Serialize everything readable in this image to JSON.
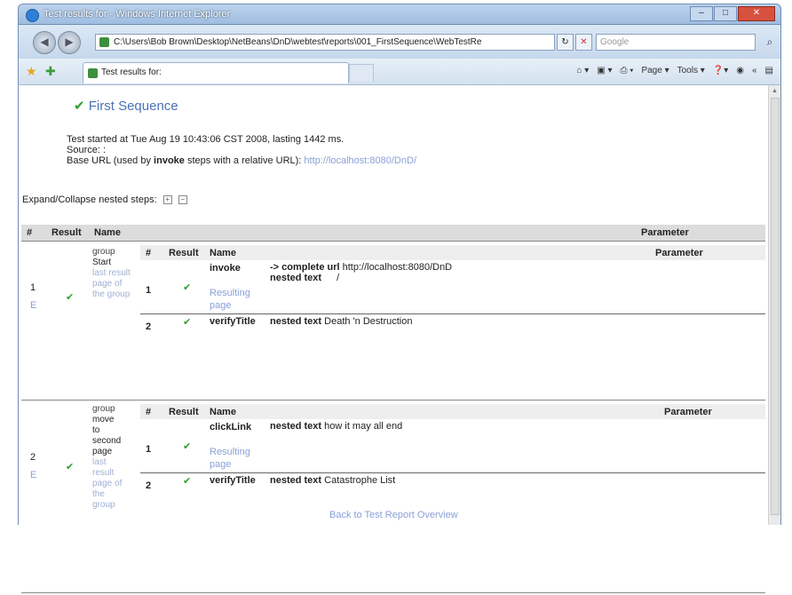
{
  "window": {
    "title": "Test results for - Windows Internet Explorer",
    "min": "–",
    "max": "□",
    "close": "✕"
  },
  "browser": {
    "back": "◀",
    "forward": "▶",
    "address": "C:\\Users\\Bob Brown\\Desktop\\NetBeans\\DnD\\webtest\\reports\\001_FirstSequence\\WebTestRe",
    "refresh_icon": "↻",
    "stop_icon": "✕",
    "search_placeholder": "Google",
    "search_icon": "⌕",
    "tab_title": "Test results for:",
    "commands": [
      "⌂ ▾",
      "▣ ▾",
      "⎙ ▾",
      "Page ▾",
      "Tools ▾",
      "❓▾",
      "◉",
      "«",
      "▤"
    ]
  },
  "report": {
    "heading": "First Sequence",
    "started": "Test started at Tue Aug 19 10:43:06 CST 2008, lasting 1442 ms.",
    "source": "Source: :",
    "base_url_prefix": "Base URL (used by",
    "base_url_keyword": "invoke",
    "base_url_suffix": "steps with a relative URL):",
    "base_url": "http://localhost:8080/DnD/",
    "expand_label": "Expand/Collapse nested steps:",
    "expand_plus": "+",
    "expand_minus": "−",
    "columns": {
      "num": "#",
      "result": "Result",
      "name": "Name",
      "parameter": "Parameter"
    },
    "groups": [
      {
        "num": "1",
        "collapse": "E",
        "type": "group",
        "name": "Start",
        "last_result": "last result page of the group",
        "steps": [
          {
            "num": "1",
            "name": "invoke",
            "resulting": "Resulting page",
            "p1_label": "-> complete url",
            "p1_value": "http://localhost:8080/DnD",
            "p2_label": "nested text",
            "p2_value": "/"
          },
          {
            "num": "2",
            "name": "verifyTitle",
            "p1_label": "nested text",
            "p1_value": "Death 'n Destruction"
          }
        ]
      },
      {
        "num": "2",
        "collapse": "E",
        "type": "group",
        "name": "move to second page",
        "last_result": "last result page of the group",
        "steps": [
          {
            "num": "1",
            "name": "clickLink",
            "resulting": "Resulting page",
            "p1_label": "nested text",
            "p1_value": "how it may all end"
          },
          {
            "num": "2",
            "name": "verifyTitle",
            "p1_label": "nested text",
            "p1_value": "Catastrophe List"
          }
        ]
      }
    ],
    "footer_link": "Back to Test Report Overview"
  }
}
